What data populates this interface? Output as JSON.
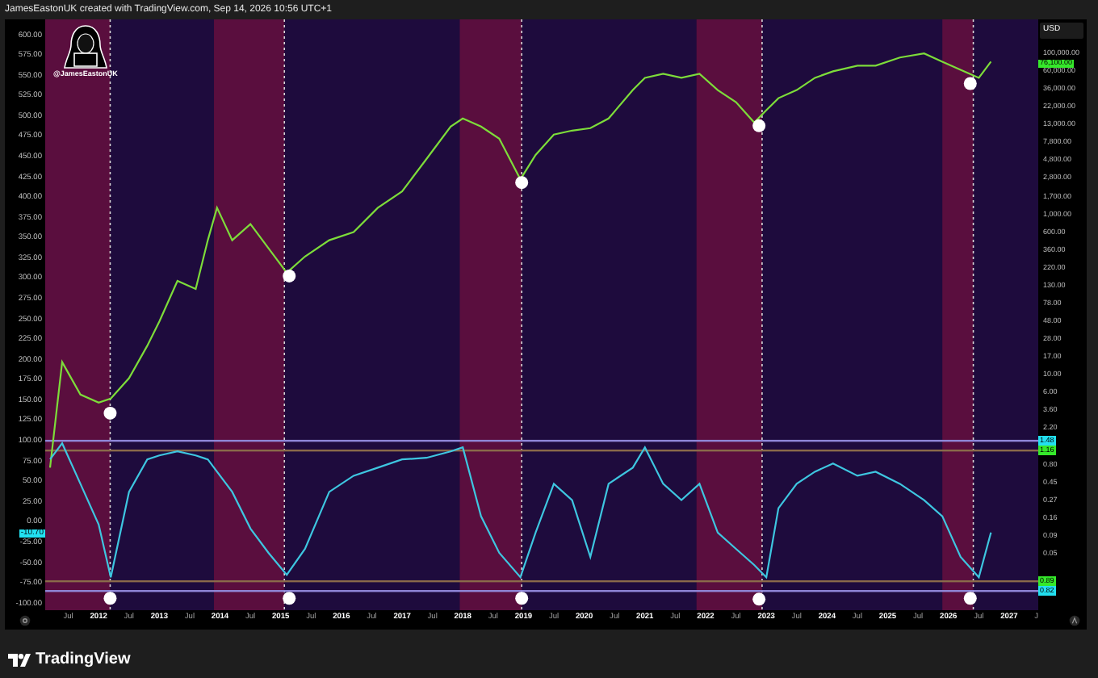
{
  "header": {
    "caption": "JamesEastonUK created with TradingView.com, Sep 14, 2026 10:56 UTC+1"
  },
  "chart_logo": {
    "handle": "@JamesEastonUK"
  },
  "right_axis": {
    "unit": "USD",
    "labels": [
      "100,000.00",
      "60,000.00",
      "36,000.00",
      "22,000.00",
      "13,000.00",
      "7,800.00",
      "4,800.00",
      "2,800.00",
      "1,700.00",
      "1,000.00",
      "600.00",
      "360.00",
      "220.00",
      "130.00",
      "78.00",
      "48.00",
      "28.00",
      "17.00",
      "10.00",
      "6.00",
      "3.60",
      "2.20"
    ],
    "lower_labels": [
      "0.80",
      "0.45",
      "0.27",
      "0.16",
      "0.09",
      "0.05"
    ],
    "price_badge": "76,100.00"
  },
  "left_axis": {
    "value_badge": "-10.70"
  },
  "chart": {
    "levels": [
      {
        "label": "1.48",
        "kind": "primary"
      },
      {
        "label": "1.16",
        "kind": "secondary"
      },
      {
        "label": "0.89",
        "kind": "secondary"
      },
      {
        "label": "0.82",
        "kind": "primary"
      }
    ],
    "chart_data": {
      "type": "line",
      "x": [
        2011.2,
        2011.4,
        2011.7,
        2012.0,
        2012.2,
        2012.5,
        2012.8,
        2013.0,
        2013.3,
        2013.6,
        2013.8,
        2013.95,
        2014.2,
        2014.5,
        2014.8,
        2015.1,
        2015.4,
        2015.8,
        2016.2,
        2016.6,
        2017.0,
        2017.4,
        2017.8,
        2018.0,
        2018.3,
        2018.6,
        2018.95,
        2019.2,
        2019.5,
        2019.8,
        2020.1,
        2020.4,
        2020.8,
        2021.0,
        2021.3,
        2021.6,
        2021.9,
        2022.2,
        2022.5,
        2022.8,
        2023.0,
        2023.2,
        2023.5,
        2023.8,
        2024.1,
        2024.5,
        2024.8,
        2025.2,
        2025.6,
        2025.9,
        2026.2,
        2026.5,
        2026.7
      ],
      "series": [
        {
          "color": "#7ddc3a",
          "values": [
            70,
            200,
            160,
            150,
            155,
            180,
            220,
            250,
            300,
            290,
            350,
            390,
            350,
            370,
            340,
            310,
            330,
            350,
            360,
            390,
            410,
            450,
            490,
            500,
            490,
            475,
            425,
            455,
            480,
            485,
            488,
            500,
            535,
            550,
            555,
            550,
            555,
            535,
            520,
            495,
            510,
            525,
            535,
            550,
            558,
            565,
            565,
            575,
            580,
            570,
            560,
            550,
            570
          ]
        },
        {
          "color": "#3ec6e0",
          "values": [
            80,
            100,
            50,
            0,
            -65,
            40,
            80,
            85,
            90,
            85,
            80,
            65,
            40,
            -5,
            -35,
            -62,
            -30,
            40,
            60,
            70,
            80,
            82,
            90,
            95,
            10,
            -35,
            -65,
            -10,
            50,
            30,
            -40,
            50,
            70,
            95,
            50,
            30,
            50,
            -10,
            -30,
            -50,
            -65,
            20,
            50,
            65,
            75,
            60,
            65,
            50,
            30,
            10,
            -40,
            -65,
            -10
          ]
        },
        {
          "type": "scatter",
          "color": "#ffffff",
          "x": [
            2012.19,
            2015.14,
            2018.97,
            2022.88,
            2026.36,
            2012.19,
            2015.14,
            2018.97,
            2022.88,
            2026.36
          ],
          "values": [
            137,
            306,
            421,
            491,
            543,
            -91,
            -91,
            -91,
            -92,
            -91
          ]
        }
      ],
      "bands": [
        {
          "axis": "x",
          "from": 2011.12,
          "to": 2012.19,
          "color": "#5a0e3e"
        },
        {
          "axis": "x",
          "from": 2013.9,
          "to": 2015.06,
          "color": "#5a0e3e"
        },
        {
          "axis": "x",
          "from": 2017.95,
          "to": 2018.97,
          "color": "#5a0e3e"
        },
        {
          "axis": "x",
          "from": 2021.85,
          "to": 2022.93,
          "color": "#5a0e3e"
        },
        {
          "axis": "x",
          "from": 2025.9,
          "to": 2026.41,
          "color": "#5a0e3e"
        }
      ],
      "ref_lines": [
        {
          "axis": "x",
          "value": 2012.19,
          "color": "#d8d8d8"
        },
        {
          "axis": "x",
          "value": 2015.06,
          "color": "#d8d8d8"
        },
        {
          "axis": "x",
          "value": 2018.97,
          "color": "#d8d8d8"
        },
        {
          "axis": "x",
          "value": 2022.93,
          "color": "#d8d8d8"
        },
        {
          "axis": "x",
          "value": 2026.41,
          "color": "#d8d8d8"
        },
        {
          "axis": "y",
          "value": 103,
          "color": "#8f86d8"
        },
        {
          "axis": "y",
          "value": 91,
          "color": "#8a6a4a"
        },
        {
          "axis": "y",
          "value": -70,
          "color": "#8a6a4a"
        },
        {
          "axis": "y",
          "value": -82,
          "color": "#8f86d8"
        }
      ],
      "xlim": [
        2011.12,
        2027.48
      ],
      "ylim": [
        -100,
        622
      ],
      "xticks": [
        {
          "value": 2011.5,
          "label": "Jul"
        },
        {
          "value": 2012,
          "label": "2012"
        },
        {
          "value": 2012.5,
          "label": "Jul"
        },
        {
          "value": 2013,
          "label": "2013"
        },
        {
          "value": 2013.5,
          "label": "Jul"
        },
        {
          "value": 2014,
          "label": "2014"
        },
        {
          "value": 2014.5,
          "label": "Jul"
        },
        {
          "value": 2015,
          "label": "2015"
        },
        {
          "value": 2015.5,
          "label": "Jul"
        },
        {
          "value": 2016,
          "label": "2016"
        },
        {
          "value": 2016.5,
          "label": "Jul"
        },
        {
          "value": 2017,
          "label": "2017"
        },
        {
          "value": 2017.5,
          "label": "Jul"
        },
        {
          "value": 2018,
          "label": "2018"
        },
        {
          "value": 2018.5,
          "label": "Jul"
        },
        {
          "value": 2019,
          "label": "2019"
        },
        {
          "value": 2019.5,
          "label": "Jul"
        },
        {
          "value": 2020,
          "label": "2020"
        },
        {
          "value": 2020.5,
          "label": "Jul"
        },
        {
          "value": 2021,
          "label": "2021"
        },
        {
          "value": 2021.5,
          "label": "Jul"
        },
        {
          "value": 2022,
          "label": "2022"
        },
        {
          "value": 2022.5,
          "label": "Jul"
        },
        {
          "value": 2023,
          "label": "2023"
        },
        {
          "value": 2023.5,
          "label": "Jul"
        },
        {
          "value": 2024,
          "label": "2024"
        },
        {
          "value": 2024.5,
          "label": "Jul"
        },
        {
          "value": 2025,
          "label": "2025"
        },
        {
          "value": 2025.5,
          "label": "Jul"
        },
        {
          "value": 2026,
          "label": "2026"
        },
        {
          "value": 2026.5,
          "label": "Jul"
        },
        {
          "value": 2027,
          "label": "2027"
        },
        {
          "value": 2027.45,
          "label": "J"
        }
      ],
      "yticks": [
        {
          "value": 600,
          "label": "600.00"
        },
        {
          "value": 575,
          "label": "575.00"
        },
        {
          "value": 550,
          "label": "550.00"
        },
        {
          "value": 525,
          "label": "525.00"
        },
        {
          "value": 500,
          "label": "500.00"
        },
        {
          "value": 475,
          "label": "475.00"
        },
        {
          "value": 450,
          "label": "450.00"
        },
        {
          "value": 425,
          "label": "425.00"
        },
        {
          "value": 400,
          "label": "400.00"
        },
        {
          "value": 375,
          "label": "375.00"
        },
        {
          "value": 350,
          "label": "350.00"
        },
        {
          "value": 325,
          "label": "325.00"
        },
        {
          "value": 300,
          "label": "300.00"
        },
        {
          "value": 275,
          "label": "275.00"
        },
        {
          "value": 250,
          "label": "250.00"
        },
        {
          "value": 225,
          "label": "225.00"
        },
        {
          "value": 200,
          "label": "200.00"
        },
        {
          "value": 175,
          "label": "175.00"
        },
        {
          "value": 150,
          "label": "150.00"
        },
        {
          "value": 125,
          "label": "125.00"
        },
        {
          "value": 100,
          "label": "100.00"
        },
        {
          "value": 75,
          "label": "75.00"
        },
        {
          "value": 50,
          "label": "50.00"
        },
        {
          "value": 25,
          "label": "25.00"
        },
        {
          "value": 0,
          "label": "0.00"
        },
        {
          "value": -25,
          "label": "-25.00"
        },
        {
          "value": -50,
          "label": "-50.00"
        },
        {
          "value": -75,
          "label": "-75.00"
        },
        {
          "value": -100,
          "label": "-100.00"
        }
      ]
    }
  },
  "footer": {
    "brand": "TradingView"
  }
}
